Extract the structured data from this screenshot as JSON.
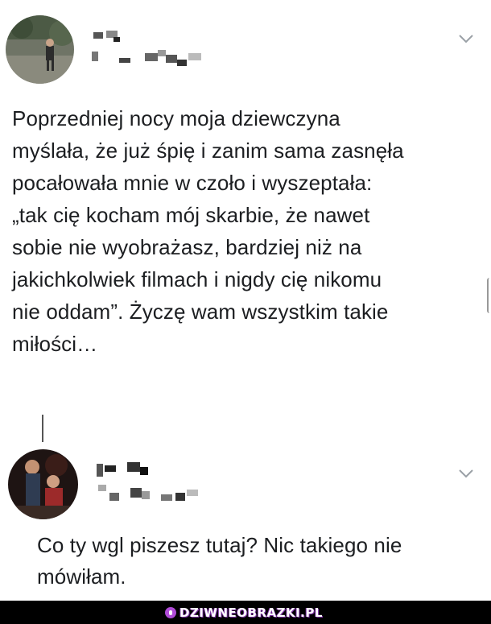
{
  "post": {
    "text": "Poprzedniej nocy moja dziewczyna\nmyślała, że już śpię i zanim sama zasnęła\npocałowała mnie w czoło i wyszeptała:\n„tak cię kocham mój skarbie, że nawet\nsobie nie wyobrażasz, bardziej niż na\njakichkolwiek filmach i nigdy cię nikomu\nnie oddam”. Życzę wam wszystkim takie\nmiłości…",
    "menu_icon": "chevron-down-icon"
  },
  "reply": {
    "text": "Co ty wgl piszesz tutaj? Nic takiego nie\nmówiłam.",
    "menu_icon": "chevron-down-icon"
  },
  "watermark": {
    "text": "DZIWNEOBRAZKI.PL",
    "color": "#b04bd8"
  },
  "colors": {
    "background": "#ffffff",
    "text": "#1c1e21",
    "footer": "#000000"
  }
}
